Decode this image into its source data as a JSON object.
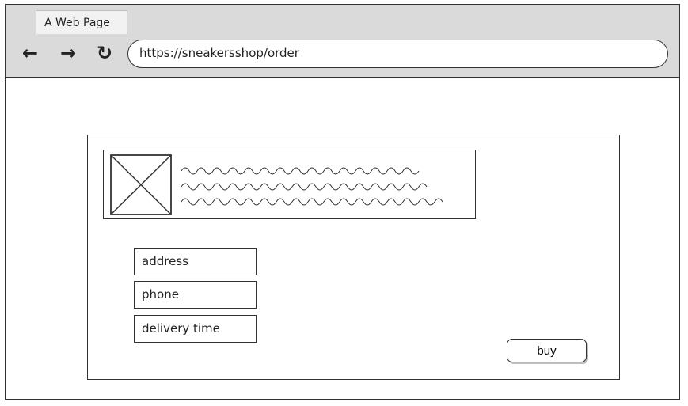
{
  "browser": {
    "tab_title": "A Web Page",
    "url": "https://sneakersshop/order",
    "icons": [
      "back-arrow-icon",
      "forward-arrow-icon",
      "reload-icon"
    ]
  },
  "product": {
    "image_icon": "image-placeholder-icon"
  },
  "form": {
    "address_label": "address",
    "phone_label": "phone",
    "delivery_label": "delivery time",
    "buy_label": "buy"
  }
}
